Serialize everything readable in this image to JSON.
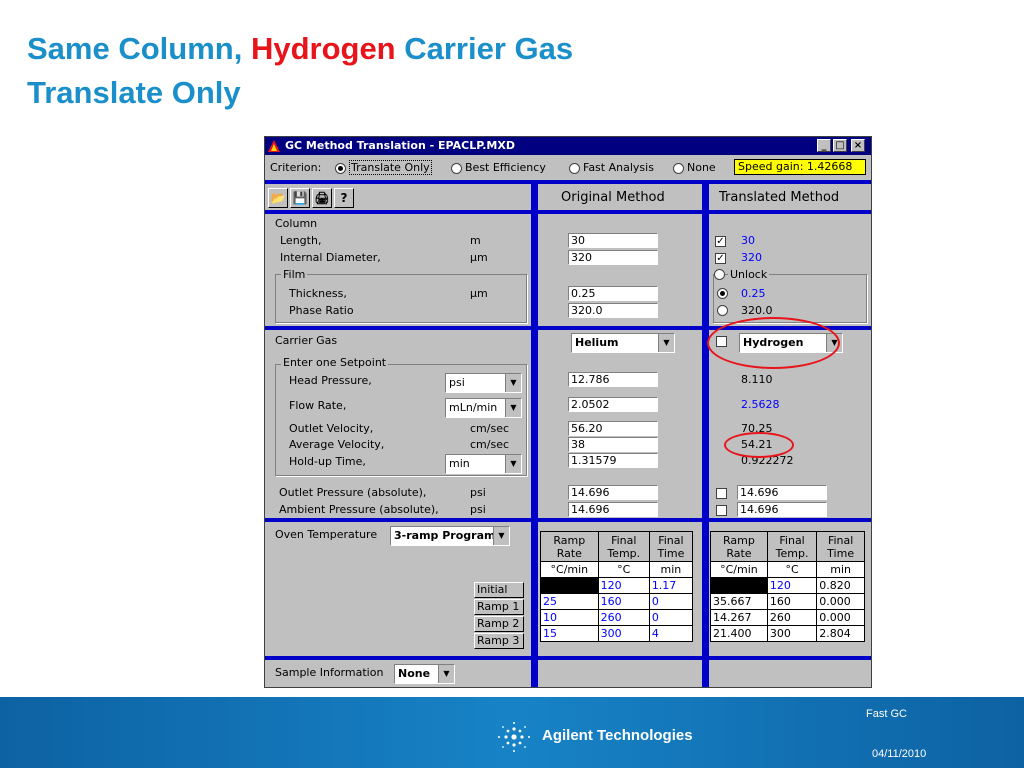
{
  "slide": {
    "title_part1": "Same Column, ",
    "title_highlight": "Hydrogen",
    "title_part2": " Carrier Gas",
    "title_line2": "Translate Only"
  },
  "window": {
    "title": "GC Method Translation - EPACLP.MXD",
    "criterion_label": "Criterion:",
    "criteria": [
      {
        "label": "Translate Only",
        "selected": true
      },
      {
        "label": "Best Efficiency",
        "selected": false
      },
      {
        "label": "Fast Analysis",
        "selected": false
      },
      {
        "label": "None",
        "selected": false
      }
    ],
    "speed_gain": "Speed gain: 1.42668",
    "original_header": "Original Method",
    "translated_header": "Translated Method"
  },
  "column": {
    "group_label": "Column",
    "length_label": "Length,",
    "length_unit": "m",
    "length_orig": "30",
    "length_trans": "30",
    "diameter_label": "Internal Diameter,",
    "diameter_unit": "µm",
    "diameter_orig": "320",
    "diameter_trans": "320",
    "film_label": "Film",
    "unlock_label": "Unlock",
    "thickness_label": "Thickness,",
    "thickness_unit": "µm",
    "thickness_orig": "0.25",
    "thickness_trans": "0.25",
    "phase_label": "Phase Ratio",
    "phase_orig": "320.0",
    "phase_trans": "320.0"
  },
  "carrier": {
    "group_label": "Carrier Gas",
    "gas_orig": "Helium",
    "gas_trans": "Hydrogen",
    "setpoint_label": "Enter one Setpoint",
    "head_label": "Head Pressure,",
    "head_unit": "psi",
    "head_orig": "12.786",
    "head_trans": "8.110",
    "flow_label": "Flow Rate,",
    "flow_unit": "mLn/min",
    "flow_orig": "2.0502",
    "flow_trans": "2.5628",
    "outlet_vel_label": "Outlet Velocity,",
    "outlet_vel_unit": "cm/sec",
    "outlet_vel_orig": "56.20",
    "outlet_vel_trans": "70.25",
    "avg_vel_label": "Average Velocity,",
    "avg_vel_unit": "cm/sec",
    "avg_vel_orig": "38",
    "avg_vel_trans": "54.21",
    "holdup_label": "Hold-up Time,",
    "holdup_unit": "min",
    "holdup_orig": "1.31579",
    "holdup_trans": "0.922272",
    "outlet_p_label": "Outlet Pressure (absolute),",
    "outlet_p_unit": "psi",
    "outlet_p_orig": "14.696",
    "outlet_p_trans": "14.696",
    "ambient_p_label": "Ambient Pressure (absolute),",
    "ambient_p_unit": "psi",
    "ambient_p_orig": "14.696",
    "ambient_p_trans": "14.696"
  },
  "oven": {
    "label": "Oven Temperature",
    "program": "3-ramp Program",
    "row_labels": [
      "Initial",
      "Ramp 1",
      "Ramp 2",
      "Ramp 3"
    ],
    "headers": {
      "rate_line1": "Ramp",
      "rate_line2": "Rate",
      "temp_line1": "Final",
      "temp_line2": "Temp.",
      "time_line1": "Final",
      "time_line2": "Time",
      "rate_unit": "°C/min",
      "temp_unit": "°C",
      "time_unit": "min"
    },
    "original_rows": [
      [
        "",
        "120",
        "1.17"
      ],
      [
        "25",
        "160",
        "0"
      ],
      [
        "10",
        "260",
        "0"
      ],
      [
        "15",
        "300",
        "4"
      ]
    ],
    "translated_rows": [
      [
        "",
        "120",
        "0.820"
      ],
      [
        "35.667",
        "160",
        "0.000"
      ],
      [
        "14.267",
        "260",
        "0.000"
      ],
      [
        "21.400",
        "300",
        "2.804"
      ]
    ]
  },
  "sample": {
    "label": "Sample Information",
    "value": "None"
  },
  "footer": {
    "company": "Agilent Technologies",
    "topic": "Fast GC",
    "date": "04/11/2010"
  }
}
